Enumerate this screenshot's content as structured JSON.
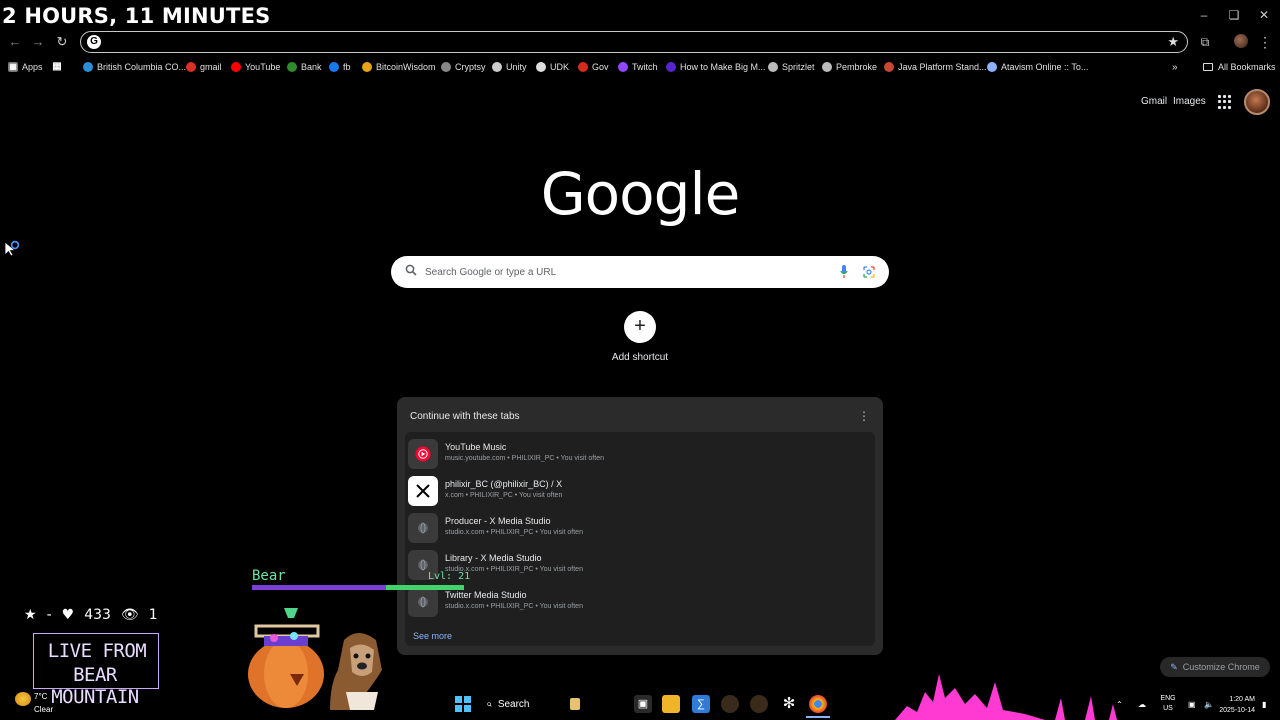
{
  "stream": {
    "timer": "2 HOURS, 11 MINUTES",
    "stats": {
      "star": "★",
      "dash": "-",
      "likes": "433",
      "viewers": "1"
    },
    "live_line1": "LIVE FROM",
    "live_line2": "BEAR MOUNTAIN",
    "pet": {
      "name": "Bear",
      "level": "Lvl: 21",
      "xp_fraction": 0.63
    }
  },
  "toolbar": {
    "url": ""
  },
  "bookmarks": {
    "apps_label": "Apps",
    "items": [
      {
        "label": "British Columbia CO...",
        "icon": "bc-icon",
        "color": "#2a8fd8"
      },
      {
        "label": "gmail",
        "icon": "gmail-icon",
        "color": "#d93025"
      },
      {
        "label": "YouTube",
        "icon": "youtube-icon",
        "color": "#ff0000"
      },
      {
        "label": "Bank",
        "icon": "td-icon",
        "color": "#2e8b2e"
      },
      {
        "label": "fb",
        "icon": "facebook-icon",
        "color": "#1877f2"
      },
      {
        "label": "BitcoinWisdom",
        "icon": "bitcoinwisdom-icon",
        "color": "#e8a317"
      },
      {
        "label": "Cryptsy",
        "icon": "cryptsy-icon",
        "color": "#888888"
      },
      {
        "label": "Unity",
        "icon": "unity-icon",
        "color": "#cccccc"
      },
      {
        "label": "UDK",
        "icon": "udk-icon",
        "color": "#dddddd"
      },
      {
        "label": "Gov",
        "icon": "canada-icon",
        "color": "#d52b1e"
      },
      {
        "label": "Twitch",
        "icon": "twitch-icon",
        "color": "#9146ff"
      },
      {
        "label": "How to Make Big M...",
        "icon": "udemy-icon",
        "color": "#5624d0"
      },
      {
        "label": "Spritzlet",
        "icon": "globe-icon",
        "color": "#bbbbbb"
      },
      {
        "label": "Pembroke",
        "icon": "globe-icon",
        "color": "#bbbbbb"
      },
      {
        "label": "Java Platform Stand...",
        "icon": "oracle-icon",
        "color": "#c74634"
      },
      {
        "label": "Atavism Online :: To...",
        "icon": "atavism-icon",
        "color": "#8fb0ff"
      }
    ],
    "all_bookmarks": "All Bookmarks",
    "overflow": "»"
  },
  "ntp": {
    "gmail": "Gmail",
    "images": "Images",
    "logo": "Google",
    "search_placeholder": "Search Google or type a URL",
    "add_shortcut": "Add shortcut",
    "add_symbol": "+",
    "customize": "Customize Chrome",
    "tabs_card": {
      "title": "Continue with these tabs",
      "see_more": "See more",
      "items": [
        {
          "title": "YouTube Music",
          "meta": "music.youtube.com • PHILIXIR_PC • You visit often",
          "icon": "youtube-music-icon"
        },
        {
          "title": "philixir_BC (@philixir_BC) / X",
          "meta": "x.com • PHILIXIR_PC • You visit often",
          "icon": "x-icon"
        },
        {
          "title": "Producer - X Media Studio",
          "meta": "studio.x.com • PHILIXIR_PC • You visit often",
          "icon": "globe-icon"
        },
        {
          "title": "Library - X Media Studio",
          "meta": "studio.x.com • PHILIXIR_PC • You visit often",
          "icon": "globe-icon"
        },
        {
          "title": "Twitter Media Studio",
          "meta": "studio.x.com • PHILIXIR_PC • You visit often",
          "icon": "globe-icon"
        }
      ]
    }
  },
  "taskbar": {
    "weather_temp": "7°C",
    "weather_desc": "Clear",
    "search_label": "Search",
    "lang_top": "ENG",
    "lang_bottom": "US",
    "time": "1:20 AM",
    "date": "2025-10-14"
  }
}
